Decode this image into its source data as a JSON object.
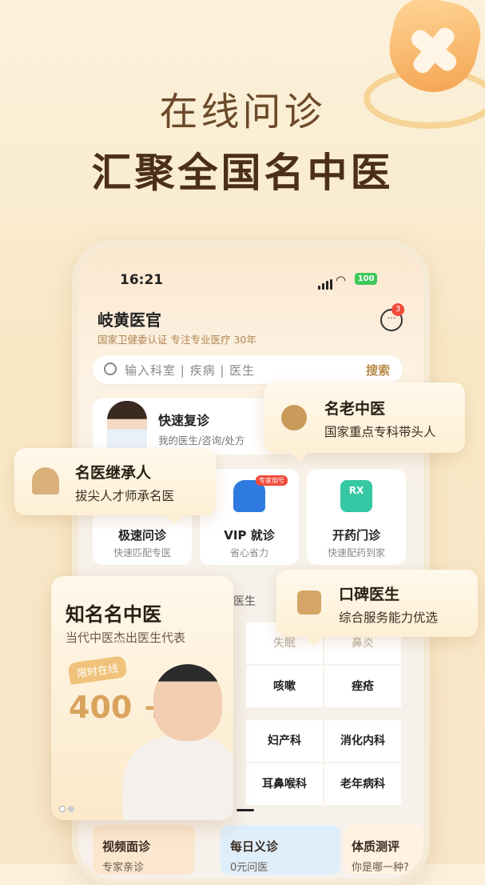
{
  "hero": {
    "title": "在线问诊",
    "subtitle": "汇聚全国名中医"
  },
  "status_bar": {
    "time": "16:21",
    "battery": "100"
  },
  "app": {
    "name": "岐黄医官",
    "tagline": "国家卫健委认证 专注专业医疗 30年",
    "message_count": "3"
  },
  "search": {
    "placeholder": "输入科室 | 疾病 | 医生",
    "button": "搜索"
  },
  "quick_revisit": {
    "title": "快速复诊",
    "subtitle": "我的医生/咨询/处方"
  },
  "services": [
    {
      "title": "极速问诊",
      "subtitle": "快速匹配专医"
    },
    {
      "title": "VIP 就诊",
      "subtitle": "省心省力",
      "tag": "专家加号"
    },
    {
      "title": "开药门诊",
      "subtitle": "快速配药到家"
    }
  ],
  "partial_section_label": "业医生",
  "grid": [
    {
      "label": "失眠",
      "light": true
    },
    {
      "label": "鼻炎",
      "light": true
    },
    {
      "label": "咳嗽",
      "light": false
    },
    {
      "label": "痤疮",
      "light": false
    },
    {
      "label": "妇产科",
      "light": false
    },
    {
      "label": "消化内科",
      "light": false
    },
    {
      "label": "耳鼻喉科",
      "light": false
    },
    {
      "label": "老年病科",
      "light": false
    }
  ],
  "bottom_cards": [
    {
      "title": "视频面诊",
      "subtitle": "专家亲诊"
    },
    {
      "title": "每日义诊",
      "subtitle": "0元问医"
    },
    {
      "title": "体质测评",
      "subtitle": "你是哪一种?"
    }
  ],
  "bubbles": {
    "famous_old": {
      "title": "名老中医",
      "subtitle": "国家重点专科带头人"
    },
    "inheritor": {
      "title": "名医继承人",
      "subtitle": "拔尖人才师承名医"
    },
    "reputation": {
      "title": "口碑医生",
      "subtitle": "综合服务能力优选"
    }
  },
  "famous_card": {
    "title": "知名名中医",
    "subtitle": "当代中医杰出医生代表",
    "tag": "限时在线",
    "count": "400 +"
  },
  "colors": {
    "accent": "#b98a4a",
    "title_dark": "#4b2f18",
    "badge_red": "#f04a3a",
    "battery_green": "#3ec95b"
  }
}
